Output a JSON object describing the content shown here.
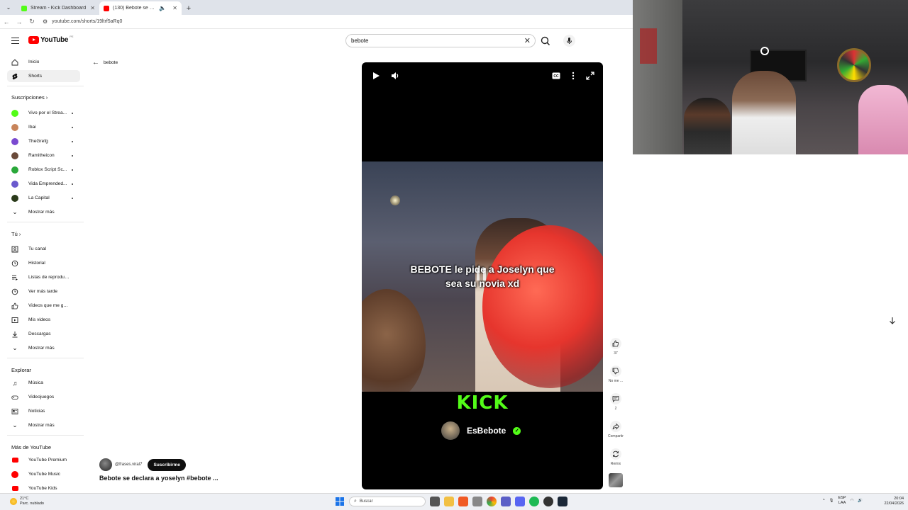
{
  "browser": {
    "tabs": [
      {
        "title": "Stream - Kick Dashboard",
        "favicon_color": "#53fc18"
      },
      {
        "title": "(130) Bebote se declara a y…",
        "favicon_color": "#ff0000"
      }
    ],
    "url": "youtube.com/shorts/19ltrf5aRq0"
  },
  "youtube": {
    "logo_text": "YouTube",
    "logo_country": "PE",
    "search_value": "bebote",
    "back_label": "bebote",
    "sidebar": {
      "main": [
        {
          "label": "Inicio",
          "icon": "home-icon"
        },
        {
          "label": "Shorts",
          "icon": "shorts-icon"
        }
      ],
      "subs_title": "Suscripciones",
      "subs": [
        {
          "label": "Vivo por el Strea...",
          "color": "#53fc18"
        },
        {
          "label": "Ibai",
          "color": "#c8845a"
        },
        {
          "label": "TheGrefg",
          "color": "#7a4ad0"
        },
        {
          "label": "Ramitheicon",
          "color": "#6a4a3a"
        },
        {
          "label": "Roblox Script Sc...",
          "color": "#2aa83a"
        },
        {
          "label": "Vida Emprended...",
          "color": "#6a5acd"
        },
        {
          "label": "La Capital",
          "color": "#2a3a1a"
        }
      ],
      "show_more": "Mostrar más",
      "you_title": "Tú",
      "you": [
        {
          "label": "Tu canal",
          "icon": "channel-icon"
        },
        {
          "label": "Historial",
          "icon": "history-icon"
        },
        {
          "label": "Listas de reproducc...",
          "icon": "playlist-icon"
        },
        {
          "label": "Ver más tarde",
          "icon": "clock-icon"
        },
        {
          "label": "Videos que me gus...",
          "icon": "thumbs-up-icon"
        },
        {
          "label": "Mis videos",
          "icon": "video-icon"
        },
        {
          "label": "Descargas",
          "icon": "download-icon"
        }
      ],
      "explore_title": "Explorar",
      "explore": [
        {
          "label": "Música",
          "icon": "music-icon"
        },
        {
          "label": "Videojuegos",
          "icon": "gamepad-icon"
        },
        {
          "label": "Noticias",
          "icon": "news-icon"
        }
      ],
      "more_title": "Más de YouTube",
      "more": [
        {
          "label": "YouTube Premium"
        },
        {
          "label": "YouTube Music"
        },
        {
          "label": "YouTube Kids"
        }
      ]
    },
    "video": {
      "caption_line1": "BEBOTE le pide a Joselyn que",
      "caption_line2": "sea su novia xd",
      "kick_text": "KICK",
      "streamer_name": "EsBebote"
    },
    "actions": {
      "like_count": "37",
      "dislike_label": "No me ...",
      "comment_count": "2",
      "share_label": "Compartir",
      "remix_label": "Remix"
    },
    "channel_handle": "@frases.viral7",
    "subscribe_label": "Suscribirme",
    "video_title": "Bebote se declara a yoselyn   #bebote ..."
  },
  "taskbar": {
    "weather_temp": "21°C",
    "weather_desc": "Parc. nublado",
    "search_placeholder": "Buscar",
    "lang_top": "ESP",
    "lang_bottom": "LAA",
    "time": "20:04",
    "date": "22/04/2026"
  }
}
